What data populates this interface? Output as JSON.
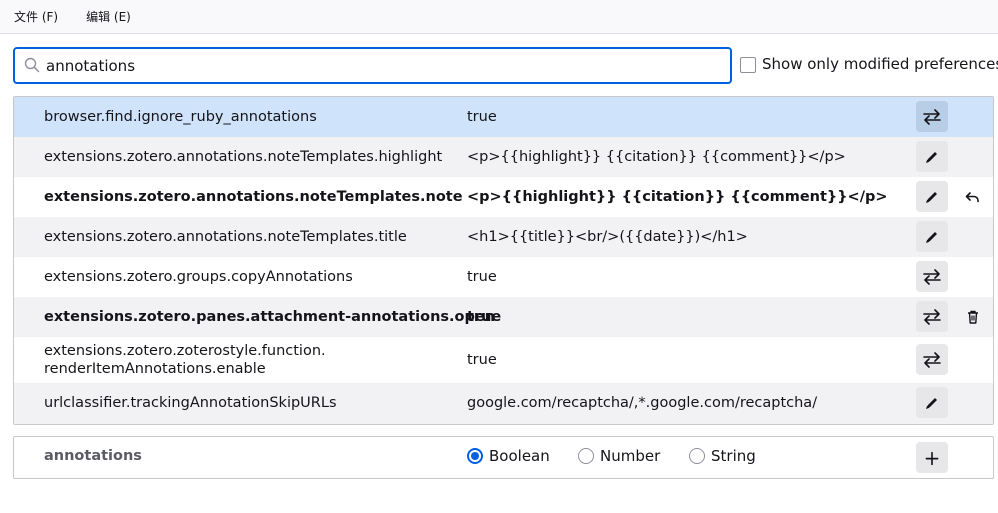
{
  "menu": {
    "file": "文件 (F)",
    "edit": "编辑 (E)"
  },
  "search": {
    "value": "annotations",
    "icon": "search-icon"
  },
  "filter": {
    "show_modified_label": "Show only modified preferences",
    "checked": false
  },
  "prefs": [
    {
      "name": "browser.find.ignore_ruby_annotations",
      "value": "true",
      "modified": false,
      "action": "toggle-icon",
      "side": ""
    },
    {
      "name": "extensions.zotero.annotations.noteTemplates.highlight",
      "value": "<p>{{highlight}} {{citation}} {{comment}}</p>",
      "modified": false,
      "action": "edit-icon",
      "side": ""
    },
    {
      "name": "extensions.zotero.annotations.noteTemplates.note",
      "value": "<p>{{highlight}} {{citation}} {{comment}}</p>",
      "modified": true,
      "action": "edit-icon",
      "side": "reset-icon"
    },
    {
      "name": "extensions.zotero.annotations.noteTemplates.title",
      "value": "<h1>{{title}}<br/>({{date}})</h1>",
      "modified": false,
      "action": "edit-icon",
      "side": ""
    },
    {
      "name": "extensions.zotero.groups.copyAnnotations",
      "value": "true",
      "modified": false,
      "action": "toggle-icon",
      "side": ""
    },
    {
      "name": "extensions.zotero.panes.attachment-annotations.open",
      "value": "true",
      "modified": true,
      "action": "toggle-icon",
      "side": "delete-icon"
    },
    {
      "name_line1": "extensions.zotero.zoterostyle.function.",
      "name_line2": "renderItemAnnotations.enable",
      "value": "true",
      "modified": false,
      "action": "toggle-icon",
      "side": ""
    },
    {
      "name": "urlclassifier.trackingAnnotationSkipURLs",
      "value": "google.com/recaptcha/,*.google.com/recaptcha/",
      "modified": false,
      "action": "edit-icon",
      "side": ""
    }
  ],
  "add_pref": {
    "name": "annotations",
    "types": [
      "Boolean",
      "Number",
      "String"
    ],
    "selected": "Boolean",
    "add_icon": "add-icon",
    "add_label": "+"
  }
}
